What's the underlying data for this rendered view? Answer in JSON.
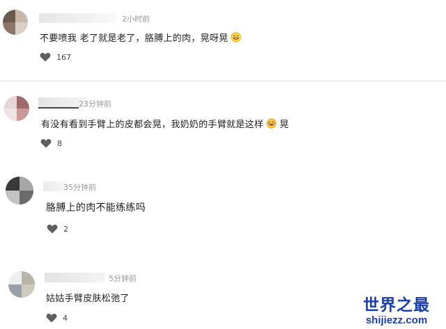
{
  "comments": [
    {
      "time": "2小时前",
      "text": "不要喷我 老了就是老了，胳膊上的肉，晃呀晃",
      "likes": "167",
      "emoji": "grinning-face-emoji"
    },
    {
      "time": "23分钟前",
      "text": "有没有看到手臂上的皮都会晃，我奶奶的手臂就是这样",
      "text_after": "晃",
      "likes": "8",
      "emoji": "laughing-face-emoji"
    },
    {
      "time": "35分钟前",
      "text": "胳膊上的肉不能练练吗",
      "likes": "2"
    },
    {
      "time": "5分钟前",
      "text": "姑姑手臂皮肤松弛了",
      "likes": "4"
    }
  ],
  "watermark": {
    "title": "世界之最",
    "url": "shijiezz.com"
  },
  "colors": {
    "like_icon": "#5f5f5f",
    "time": "#9a9a9a",
    "watermark": "#1a3fae",
    "divider": "#d6dbe3"
  },
  "icons": {
    "like": "heart-icon"
  }
}
